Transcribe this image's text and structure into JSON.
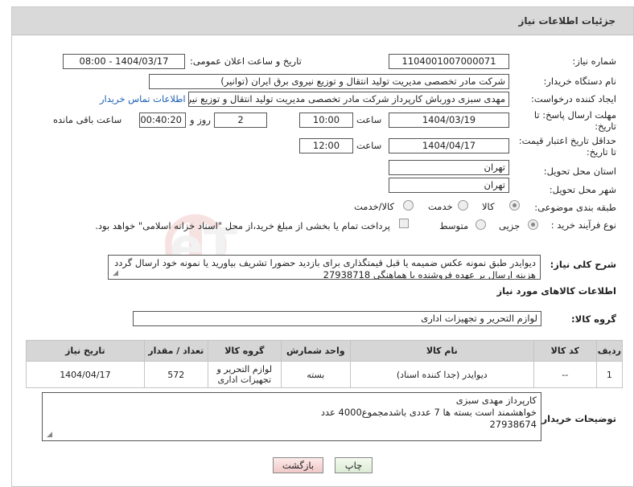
{
  "header": {
    "title": "جزئیات اطلاعات نیاز"
  },
  "form": {
    "need_number_label": "شماره نیاز:",
    "need_number": "1104001007000071",
    "announce_label": "تاریخ و ساعت اعلان عمومی:",
    "announce_value": "1404/03/17 - 08:00",
    "buyer_org_label": "نام دستگاه خریدار:",
    "buyer_org": "شرکت مادر تخصصی مدیریت تولید  انتقال و توزیع نیروی برق ایران (توانیر)",
    "creator_label": "ایجاد کننده درخواست:",
    "creator": "مهدی سبزی دورباش کارپرداز شرکت مادر تخصصی مدیریت تولید  انتقال و توزیع نیروی برق ایران (توانیر)",
    "contact_link": "اطلاعات تماس خریدار",
    "deadline_label_1": "مهلت ارسال پاسخ: تا",
    "deadline_label_2": "تاریخ:",
    "deadline_date": "1404/03/19",
    "time_label": "ساعت",
    "deadline_time": "10:00",
    "days_value": "2",
    "days_label": "روز و",
    "remaining_time": "00:40:20",
    "remaining_label": "ساعت باقی مانده",
    "min_validity_label_1": "حداقل تاریخ اعتبار قیمت:",
    "min_validity_label_2": "تا تاریخ:",
    "validity_date": "1404/04/17",
    "validity_time": "12:00",
    "province_label": "استان محل تحویل:",
    "province": "تهران",
    "city_label": "شهر محل تحویل:",
    "city": "تهران",
    "category_label": "طبقه بندی موضوعی:",
    "category_options": [
      "کالا",
      "خدمت",
      "کالا/خدمت"
    ],
    "process_label": "نوع فرآیند خرید :",
    "process_options": [
      "جزیی",
      "متوسط"
    ],
    "payment_note": "پرداخت تمام یا بخشی از مبلغ خرید،از محل \"اسناد خزانه اسلامی\" خواهد بود."
  },
  "description": {
    "label": "شرح کلی نیاز:",
    "line1": "دیوایدر طبق نمونه عکس ضمیمه یا قبل قیمتگذاری برای بازدید حضورا تشریف بیاورید یا نمونه خود ارسال گردد",
    "line2": "هزینه ارسال بر عهده فروشنده با هماهنگی 27938718"
  },
  "goods": {
    "section_title": "اطلاعات کالاهای مورد نیاز",
    "group_label": "گروه کالا:",
    "group_value": "لوازم التحریر و تجهیزات اداری",
    "columns": [
      "ردیف",
      "کد کالا",
      "نام کالا",
      "واحد شمارش",
      "گروه کالا",
      "تعداد / مقدار",
      "تاریخ نیاز"
    ],
    "rows": [
      {
        "row": "1",
        "code": "--",
        "name": "دیوایدر (جدا کننده اسناد)",
        "unit": "بسته",
        "group": "لوازم التحریر و تجهیزات اداری",
        "qty": "572",
        "date": "1404/04/17"
      }
    ]
  },
  "buyer_notes": {
    "label": "توضیحات خریدار:",
    "line1": "کارپرداز مهدی سبزی",
    "line2": "خواهشمند است بسته ها 7 عددی باشدمجموع4000 عدد",
    "line3": "27938674"
  },
  "buttons": {
    "print": "چاپ",
    "back": "بازگشت"
  },
  "colors": {
    "link": "#1a5fb4",
    "back_button_bg": "#f6d6d6",
    "print_button_bg": "#e9f6e3",
    "watermark": "#c62828"
  }
}
